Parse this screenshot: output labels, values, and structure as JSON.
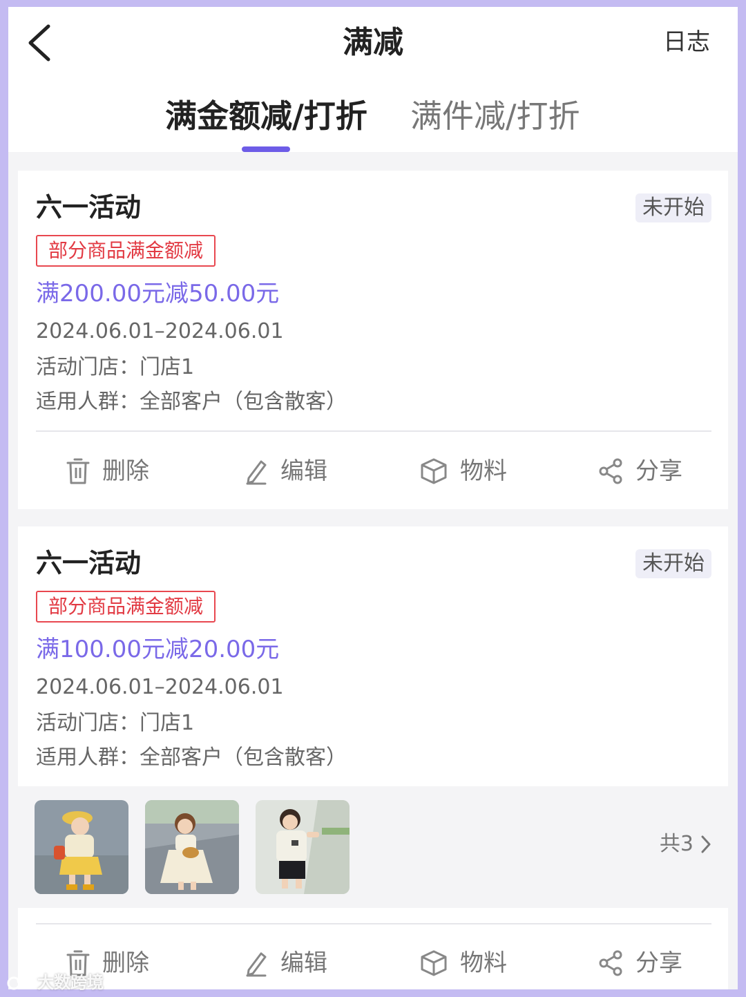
{
  "header": {
    "title": "满减",
    "log_label": "日志"
  },
  "tabs": [
    {
      "label": "满金额减/打折",
      "active": true
    },
    {
      "label": "满件减/打折",
      "active": false
    }
  ],
  "colors": {
    "accent": "#6d5ce7",
    "tag_red": "#e23a43",
    "rule_purple": "#7a69e8"
  },
  "cards": [
    {
      "title": "六一活动",
      "status": "未开始",
      "tag": "部分商品满金额减",
      "rule": "满200.00元减50.00元",
      "date_range": "2024.06.01–2024.06.01",
      "store": "活动门店：门店1",
      "audience": "适用人群：全部客户（包含散客）",
      "actions": {
        "delete": "删除",
        "edit": "编辑",
        "material": "物料",
        "share": "分享"
      }
    },
    {
      "title": "六一活动",
      "status": "未开始",
      "tag": "部分商品满金额减",
      "rule": "满100.00元减20.00元",
      "date_range": "2024.06.01–2024.06.01",
      "store": "活动门店：门店1",
      "audience": "适用人群：全部客户（包含散客）",
      "gallery_total": "共3",
      "actions": {
        "delete": "删除",
        "edit": "编辑",
        "material": "物料",
        "share": "分享"
      }
    }
  ],
  "watermark": "大数跨境"
}
